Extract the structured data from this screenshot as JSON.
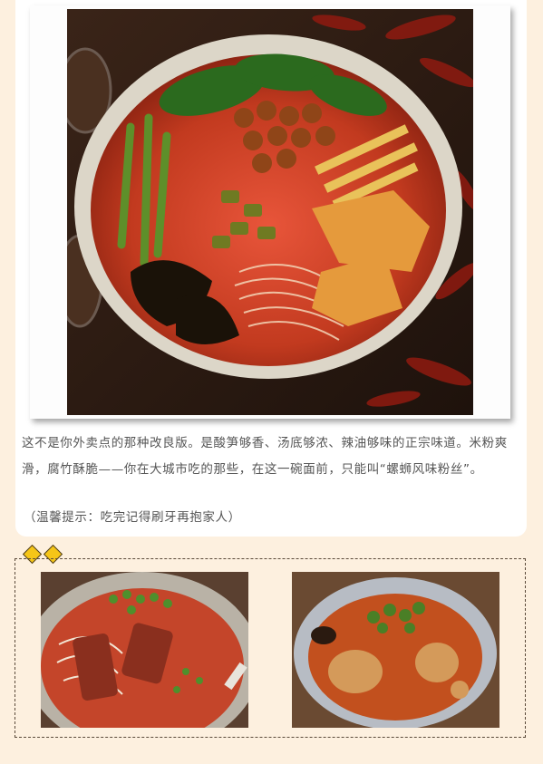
{
  "article": {
    "caption": "这不是你外卖点的那种改良版。是酸笋够香、汤底够浓、辣油够味的正宗味道。米粉爽滑，腐竹酥脆——你在大城市吃的那些，在这一碗面前，只能叫“螺蛳风味粉丝”。",
    "tip": "（温馨提示：吃完记得刷牙再抱家人）"
  },
  "images": {
    "hero": "luosifen-bowl-photo",
    "thumb_left": "beef-rice-noodle-photo",
    "thumb_right": "foil-bowl-noodle-photo"
  },
  "colors": {
    "page_bg": "#fdf0df",
    "card_bg": "#ffffff",
    "text": "#555555",
    "diamond": "#f5c518"
  }
}
